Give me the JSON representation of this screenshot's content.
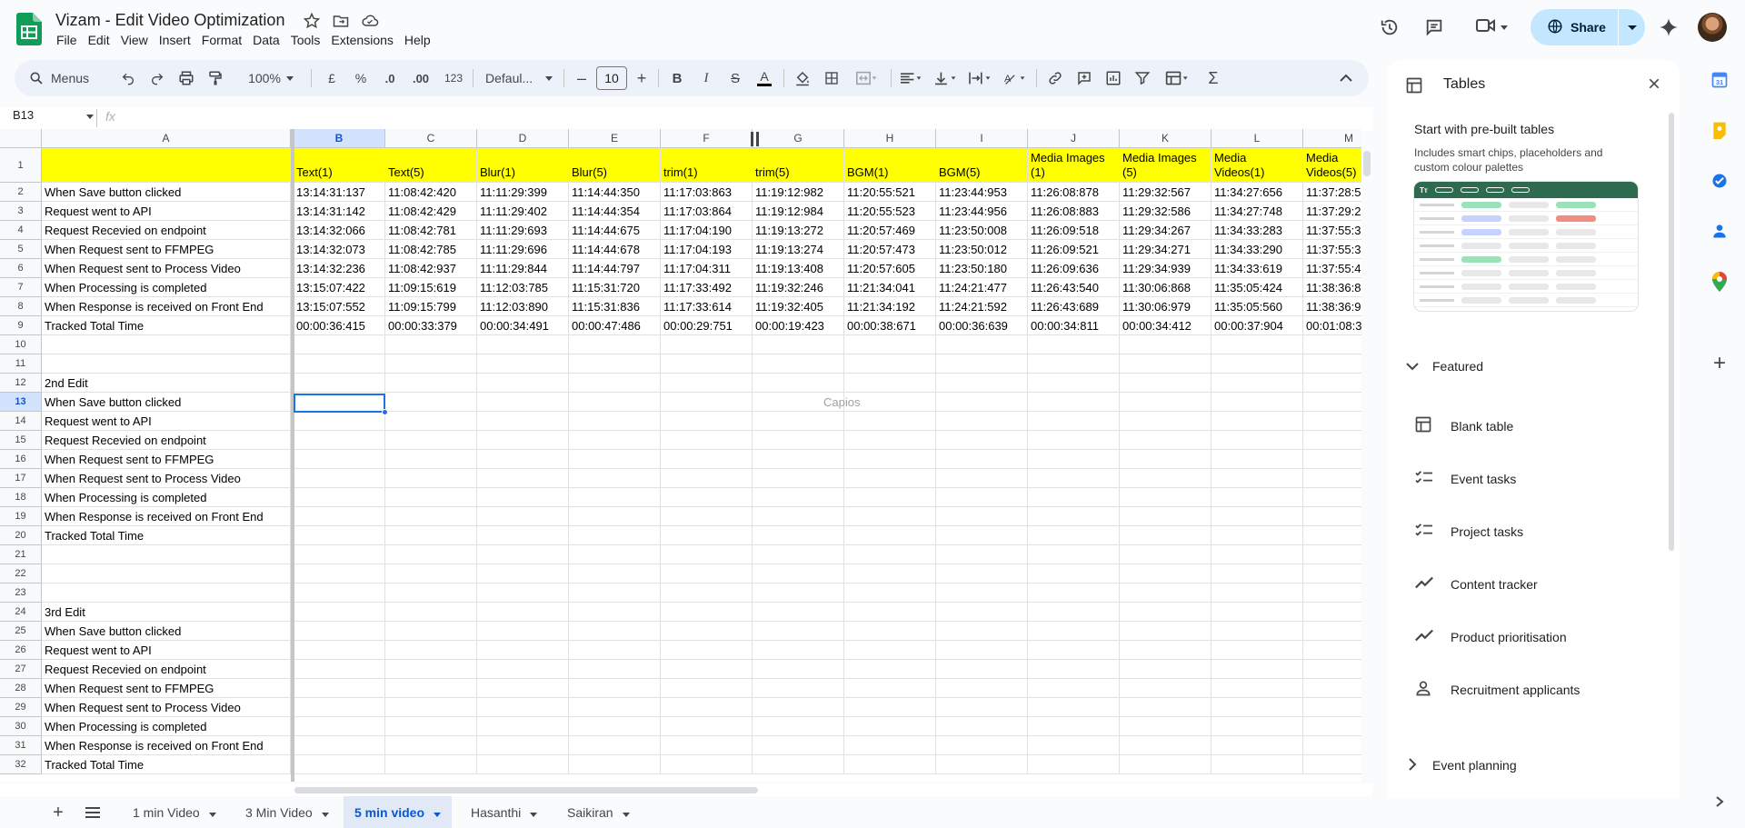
{
  "doc": {
    "title": "Vizam - Edit Video Optimization"
  },
  "menus": [
    "File",
    "Edit",
    "View",
    "Insert",
    "Format",
    "Data",
    "Tools",
    "Extensions",
    "Help"
  ],
  "share": {
    "label": "Share"
  },
  "toolbar": {
    "menus_label": "Menus",
    "zoom": "100%",
    "currency": "£",
    "percent": "%",
    "dec_dec": ".0",
    "inc_dec": ".00",
    "num_format": "123",
    "font": "Defaul...",
    "font_size": "10"
  },
  "formula": {
    "name_box": "B13",
    "fx": "fx",
    "value": ""
  },
  "grid": {
    "columns": [
      "A",
      "B",
      "C",
      "D",
      "E",
      "F",
      "G",
      "H",
      "I",
      "J",
      "K",
      "L",
      "M"
    ],
    "rows": [
      {
        "n": "1",
        "cells": [
          "",
          "Text(1)",
          "Text(5)",
          "Blur(1)",
          "Blur(5)",
          "trim(1)",
          "trim(5)",
          "BGM(1)",
          "BGM(5)",
          "Media Images (1)",
          "Media Images (5)",
          "Media Videos(1)",
          "Media Videos(5)"
        ]
      },
      {
        "n": "2",
        "cells": [
          "When Save button clicked",
          "13:14:31:137",
          "11:08:42:420",
          "11:11:29:399",
          "11:14:44:350",
          "11:17:03:863",
          "11:19:12:982",
          "11:20:55:521",
          "11:23:44:953",
          "11:26:08:878",
          "11:29:32:567",
          "11:34:27:656",
          "11:37:28:5"
        ]
      },
      {
        "n": "3",
        "cells": [
          "Request went to API",
          "13:14:31:142",
          "11:08:42:429",
          "11:11:29:402",
          "11:14:44:354",
          "11:17:03:864",
          "11:19:12:984",
          "11:20:55:523",
          "11:23:44:956",
          "11:26:08:883",
          "11:29:32:586",
          "11:34:27:748",
          "11:37:29:2"
        ]
      },
      {
        "n": "4",
        "cells": [
          "Request Recevied on endpoint",
          "13:14:32:066",
          "11:08:42:781",
          "11:11:29:693",
          "11:14:44:675",
          "11:17:04:190",
          "11:19:13:272",
          "11:20:57:469",
          "11:23:50:008",
          "11:26:09:518",
          "11:29:34:267",
          "11:34:33:283",
          "11:37:55:3"
        ]
      },
      {
        "n": "5",
        "cells": [
          "When Request sent to FFMPEG",
          "13:14:32:073",
          "11:08:42:785",
          "11:11:29:696",
          "11:14:44:678",
          "11:17:04:193",
          "11:19:13:274",
          "11:20:57:473",
          "11:23:50:012",
          "11:26:09:521",
          "11:29:34:271",
          "11:34:33:290",
          "11:37:55:3"
        ]
      },
      {
        "n": "6",
        "cells": [
          "When Request sent to Process Video",
          "13:14:32:236",
          "11:08:42:937",
          "11:11:29:844",
          "11:14:44:797",
          "11:17:04:311",
          "11:19:13:408",
          "11:20:57:605",
          "11:23:50:180",
          "11:26:09:636",
          "11:29:34:939",
          "11:34:33:619",
          "11:37:55:4"
        ]
      },
      {
        "n": "7",
        "cells": [
          "When Processing is completed",
          "13:15:07:422",
          "11:09:15:619",
          "11:12:03:785",
          "11:15:31:720",
          "11:17:33:492",
          "11:19:32:246",
          "11:21:34:041",
          "11:24:21:477",
          "11:26:43:540",
          "11:30:06:868",
          "11:35:05:424",
          "11:38:36:8"
        ]
      },
      {
        "n": "8",
        "cells": [
          "When Response is received on Front End",
          "13:15:07:552",
          "11:09:15:799",
          "11:12:03:890",
          "11:15:31:836",
          "11:17:33:614",
          "11:19:32:405",
          "11:21:34:192",
          "11:24:21:592",
          "11:26:43:689",
          "11:30:06:979",
          "11:35:05:560",
          "11:38:36:9"
        ]
      },
      {
        "n": "9",
        "cells": [
          "Tracked Total Time",
          "00:00:36:415",
          "00:00:33:379",
          "00:00:34:491",
          "00:00:47:486",
          "00:00:29:751",
          "00:00:19:423",
          "00:00:38:671",
          "00:00:36:639",
          "00:00:34:811",
          "00:00:34:412",
          "00:00:37:904",
          "00:01:08:3"
        ]
      },
      {
        "n": "10",
        "cells": [
          ""
        ]
      },
      {
        "n": "11",
        "cells": [
          ""
        ]
      },
      {
        "n": "12",
        "cells": [
          "2nd Edit"
        ]
      },
      {
        "n": "13",
        "cells": [
          "When Save button clicked"
        ]
      },
      {
        "n": "14",
        "cells": [
          "Request went to API"
        ]
      },
      {
        "n": "15",
        "cells": [
          "Request Recevied on endpoint"
        ]
      },
      {
        "n": "16",
        "cells": [
          "When Request sent to FFMPEG"
        ]
      },
      {
        "n": "17",
        "cells": [
          "When Request sent to Process Video"
        ]
      },
      {
        "n": "18",
        "cells": [
          "When Processing is completed"
        ]
      },
      {
        "n": "19",
        "cells": [
          "When Response is received on Front End"
        ]
      },
      {
        "n": "20",
        "cells": [
          "Tracked Total Time"
        ]
      },
      {
        "n": "21",
        "cells": [
          ""
        ]
      },
      {
        "n": "22",
        "cells": [
          ""
        ]
      },
      {
        "n": "23",
        "cells": [
          ""
        ]
      },
      {
        "n": "24",
        "cells": [
          "3rd Edit"
        ]
      },
      {
        "n": "25",
        "cells": [
          "When Save button clicked"
        ]
      },
      {
        "n": "26",
        "cells": [
          "Request went to API"
        ]
      },
      {
        "n": "27",
        "cells": [
          "Request Recevied on endpoint"
        ]
      },
      {
        "n": "28",
        "cells": [
          "When Request sent to FFMPEG"
        ]
      },
      {
        "n": "29",
        "cells": [
          "When Request sent to Process Video"
        ]
      },
      {
        "n": "30",
        "cells": [
          "When Processing is completed"
        ]
      },
      {
        "n": "31",
        "cells": [
          "When Response is received on Front End"
        ]
      },
      {
        "n": "32",
        "cells": [
          "Tracked Total Time"
        ]
      }
    ],
    "ghost_text": "Capios",
    "header_fill": "#ffff00"
  },
  "sheets": {
    "tabs": [
      "1 min Video",
      "3 Min Video",
      "5 min video",
      "Hasanthi",
      "Saikiran"
    ],
    "active": "5 min video"
  },
  "panel": {
    "title": "Tables",
    "heading": "Start with pre-built tables",
    "subtitle": "Includes smart chips, placeholders and custom colour palettes",
    "featured_label": "Featured",
    "items": [
      {
        "label": "Blank table",
        "icon": "table-icon"
      },
      {
        "label": "Event tasks",
        "icon": "checklist-icon"
      },
      {
        "label": "Project tasks",
        "icon": "checklist-icon"
      },
      {
        "label": "Content tracker",
        "icon": "trend-icon"
      },
      {
        "label": "Product prioritisation",
        "icon": "trend-icon"
      },
      {
        "label": "Recruitment applicants",
        "icon": "person-icon"
      }
    ],
    "event_planning_label": "Event planning"
  },
  "colors": {
    "accent": "#0b57d0",
    "share_bg": "#c2e7ff",
    "selection": "#1a73e8"
  }
}
